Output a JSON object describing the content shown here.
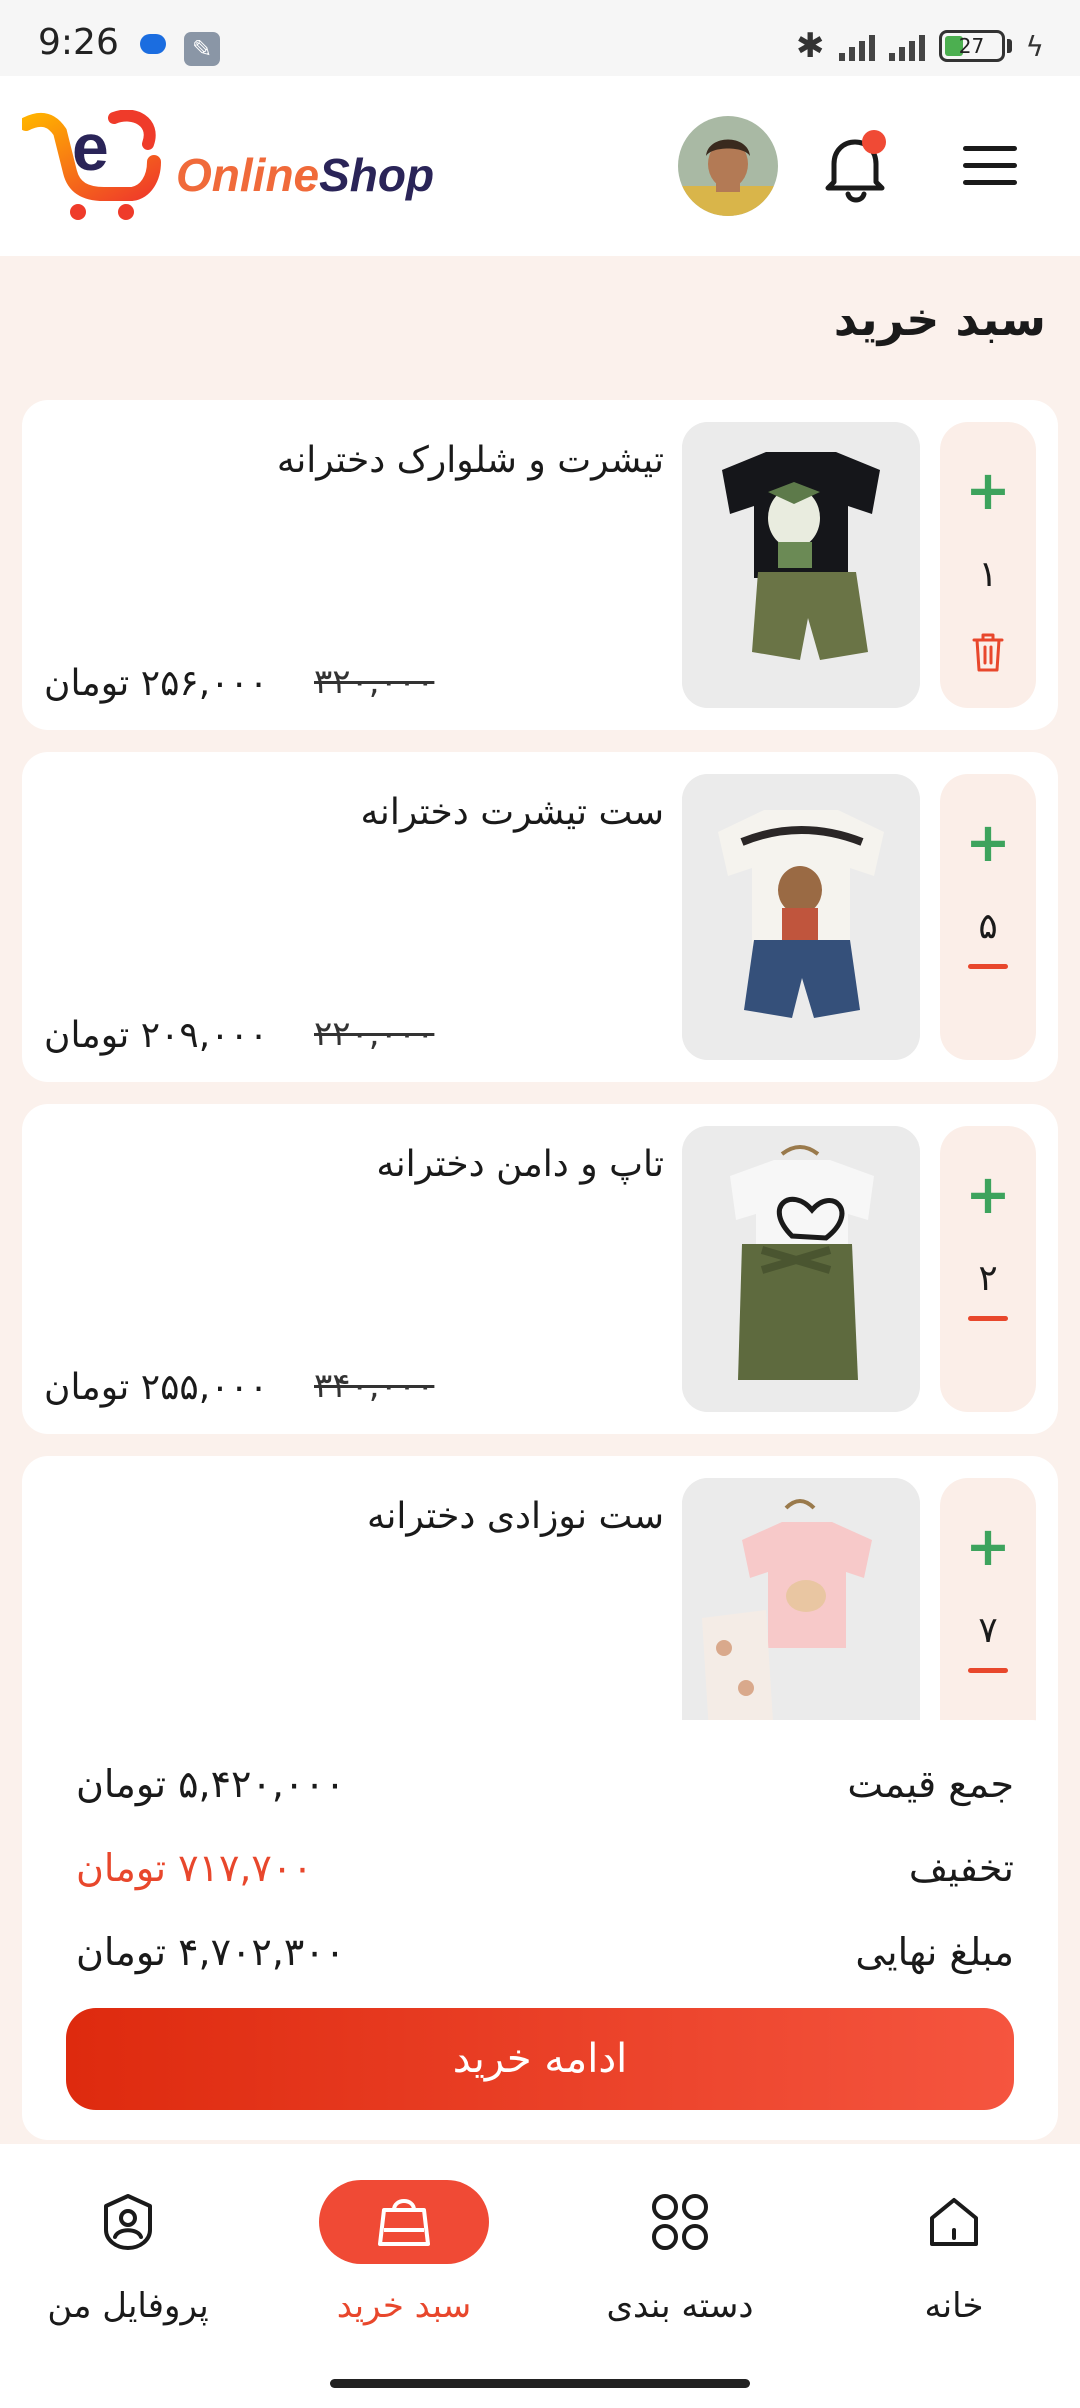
{
  "status_bar": {
    "time": "9:26",
    "battery": "27"
  },
  "header": {
    "logo_online": "Online",
    "logo_shop": "Shop"
  },
  "page": {
    "title": "سبد خرید"
  },
  "cart_items": [
    {
      "name": "تیشرت و شلوارک دخترانه",
      "quantity": "۱",
      "price_new": "۲۵۶,۰۰۰ تومان",
      "price_old": "۳۲۰,۰۰۰",
      "action_icon": "trash-icon"
    },
    {
      "name": "ست تیشرت دخترانه",
      "quantity": "۵",
      "price_new": "۲۰۹,۰۰۰ تومان",
      "price_old": "۲۲۰,۰۰۰",
      "action_icon": "minus-icon"
    },
    {
      "name": "تاپ و دامن دخترانه",
      "quantity": "۲",
      "price_new": "۲۵۵,۰۰۰ تومان",
      "price_old": "۳۴۰,۰۰۰",
      "action_icon": "minus-icon"
    },
    {
      "name": "ست نوزادی دخترانه",
      "quantity": "۷",
      "action_icon": "minus-icon"
    }
  ],
  "summary": {
    "total_label": "جمع قیمت",
    "total_value": "۵,۴۲۰,۰۰۰ تومان",
    "discount_label": "تخفیف",
    "discount_value": "۷۱۷,۷۰۰ تومان",
    "final_label": "مبلغ نهایی",
    "final_value": "۴,۷۰۲,۳۰۰ تومان",
    "checkout_label": "ادامه  خرید"
  },
  "nav": {
    "profile": "پروفایل من",
    "cart": "سبد خرید",
    "categories": "دسته بندی",
    "home": "خانه"
  },
  "colors": {
    "accent": "#f04a35",
    "plus": "#3da35d",
    "bg": "#fbf1ec"
  }
}
